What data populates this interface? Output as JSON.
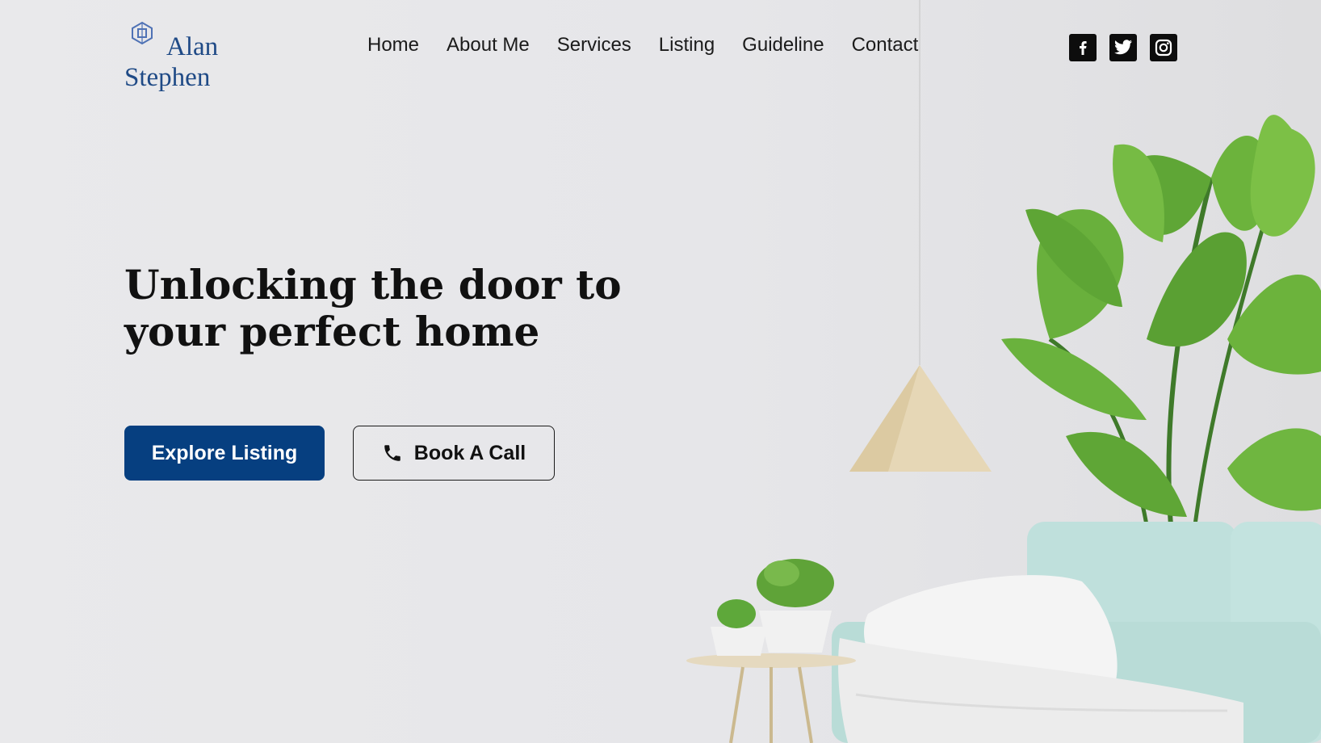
{
  "brand": {
    "line1": "Alan",
    "line2": "Stephen",
    "icon": "building-icon",
    "color": "#1f4a86"
  },
  "nav": {
    "items": [
      "Home",
      "About Me",
      "Services",
      "Listing",
      "Guideline",
      "Contact"
    ]
  },
  "social": {
    "icons": [
      "facebook-icon",
      "twitter-icon",
      "instagram-icon"
    ]
  },
  "hero": {
    "headline_line1": "Unlocking the door to",
    "headline_line2": "your perfect home",
    "primary_button": "Explore Listing",
    "secondary_button": "Book A Call",
    "secondary_icon": "phone-icon"
  },
  "colors": {
    "accent": "#063f80",
    "text": "#111111"
  }
}
